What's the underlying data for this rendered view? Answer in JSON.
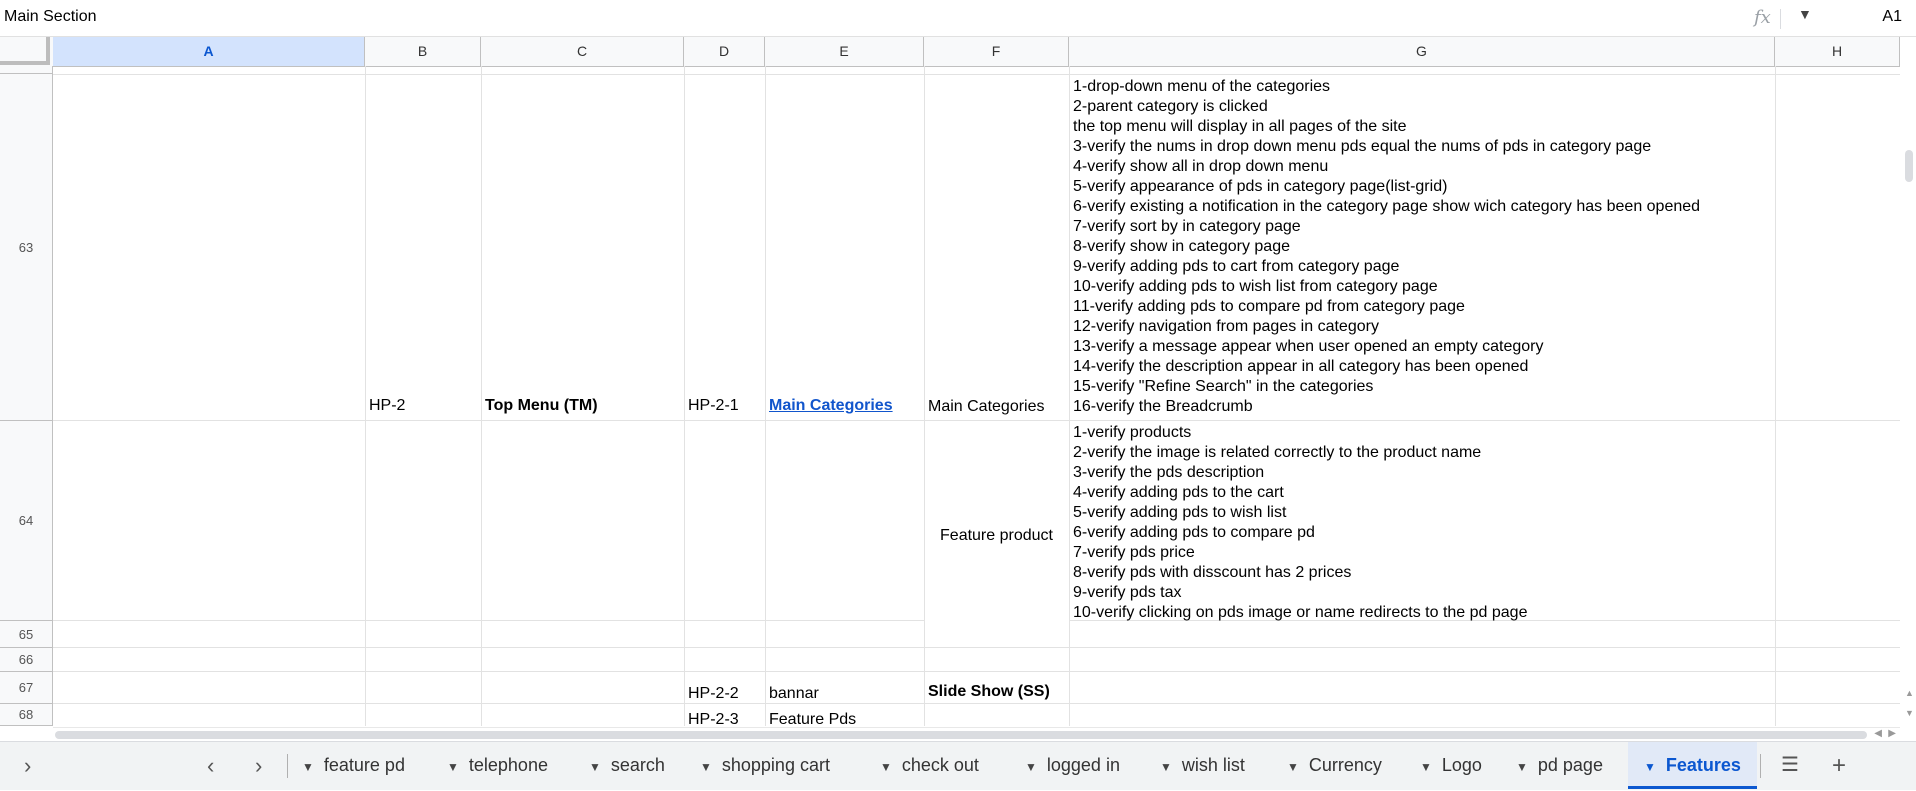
{
  "formula_bar": {
    "content": "Main Section",
    "fx_icon": "fx-icon",
    "cell_ref": "A1"
  },
  "columns": [
    "A",
    "B",
    "C",
    "D",
    "E",
    "F",
    "G",
    "H"
  ],
  "rows": [
    "63",
    "64",
    "65",
    "66",
    "67",
    "68"
  ],
  "cells": {
    "b63": "HP-2",
    "c63": "Top Menu (TM)",
    "d63": "HP-2-1",
    "e63": "Main Categories",
    "f63": "Main Categories",
    "g63": [
      "1-drop-down menu of the categories",
      "2-parent category is clicked",
      "the  top menu will display in all pages of the site",
      "3-verify the nums in drop down menu pds equal the nums of pds in category page",
      "4-verify show all in drop down menu",
      "5-verify appearance of pds in category page(list-grid)",
      "6-verify existing a notification in the category page show wich category has been opened",
      "7-verify sort by in category page",
      "8-verify show in category page",
      "9-verify adding pds to cart from category page",
      "10-verify adding pds to wish list from category page",
      "11-verify adding pds to compare pd from category page",
      "12-verify navigation from pages in category",
      "13-verify a message appear when user opened an empty category",
      "14-verify the description appear in all category has been opened",
      "15-verify \"Refine Search\" in the categories",
      "16-verify the Breadcrumb"
    ],
    "f64": "Feature product",
    "g64": [
      "1-verify products",
      "2-verify the image is related correctly to the product name",
      "3-verify the pds description",
      "4-verify adding pds to the cart",
      "5-verify adding pds to wish list",
      "6-verify adding pds to compare pd",
      "7-verify pds price",
      "8-verify pds with disscount has 2 prices",
      "9-verify pds tax",
      "10-verify clicking on pds image or name redirects to the pd page"
    ],
    "d67": "HP-2-2",
    "e67": "bannar",
    "f67": "Slide Show (SS)",
    "d68": "HP-2-3",
    "e68": "Feature  Pds"
  },
  "tabs": [
    "feature pd",
    "telephone",
    "search",
    "shopping cart",
    "check out",
    "logged in",
    "wish list",
    "Currency",
    "Logo",
    "pd page",
    "Features"
  ],
  "active_tab": "Features",
  "colors": {
    "accent": "#0b57d0",
    "selected_header": "#d3e3fd",
    "link": "#1155cc"
  }
}
